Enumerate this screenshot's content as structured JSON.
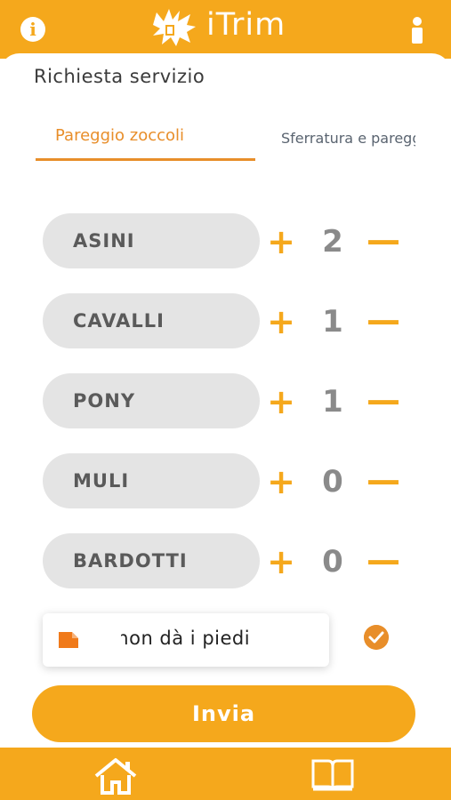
{
  "app": {
    "title": "iTrim"
  },
  "header": {
    "info_icon": "info-icon",
    "user_icon": "user-icon",
    "info_glyph": "i"
  },
  "page": {
    "title": "Richiesta servizio"
  },
  "tabs": [
    {
      "label": "Pareggio zoccoli",
      "active": true
    },
    {
      "label": "Sferratura e pareggio",
      "active": false
    }
  ],
  "animals": [
    {
      "label": "ASINI",
      "count": "2"
    },
    {
      "label": "CAVALLI",
      "count": "1"
    },
    {
      "label": "PONY",
      "count": "1"
    },
    {
      "label": "MULI",
      "count": "0"
    },
    {
      "label": "BARDOTTI",
      "count": "0"
    }
  ],
  "controls": {
    "plus": "+",
    "minus": "—"
  },
  "note": {
    "text": "Il pony non dà i piedi",
    "icon": "note-icon",
    "confirm_icon": "check-icon"
  },
  "submit": {
    "label": "Invia"
  },
  "nav": {
    "home_icon": "home-icon",
    "book_icon": "book-icon"
  },
  "colors": {
    "accent": "#f5a81c",
    "accent_dark": "#e88e2a",
    "pill": "#e4e4e4"
  }
}
